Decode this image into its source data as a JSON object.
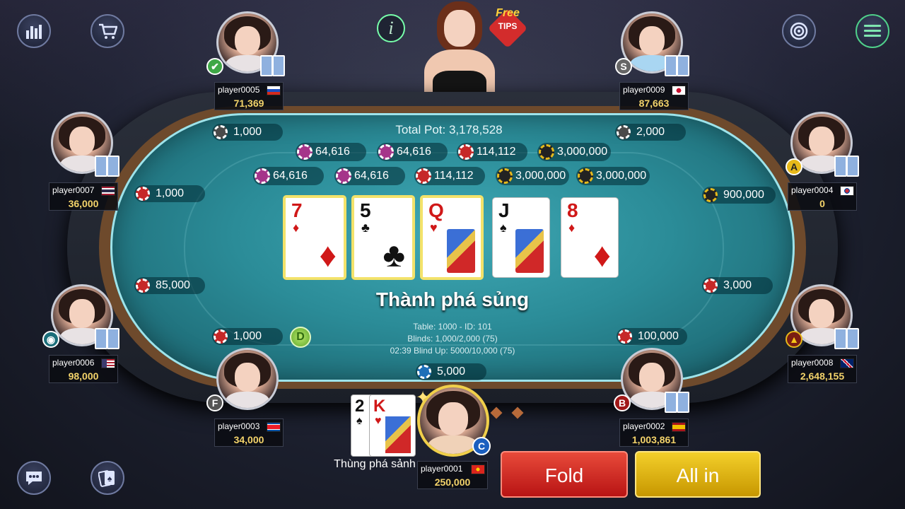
{
  "top_buttons": {
    "stats_icon": "bar-chart-icon",
    "shop_icon": "cart-icon",
    "info_icon": "info-icon",
    "target_icon": "target-icon",
    "menu_icon": "menu-icon"
  },
  "free_tips": {
    "line1": "Free",
    "line2": "TIPS"
  },
  "table": {
    "total_pot": "Total Pot: 3,178,528",
    "side_pots_row1": [
      "64,616",
      "64,616",
      "114,112",
      "3,000,000"
    ],
    "side_pots_row2": [
      "64,616",
      "64,616",
      "114,112",
      "3,000,000",
      "3,000,000"
    ],
    "hand_result": "Thành phá sủng",
    "info_line1": "Table: 1000 - ID: 101",
    "info_line2": "Blinds: 1,000/2,000 (75)",
    "info_line3": "02:39 Blind Up: 5000/10,000 (75)",
    "dealer_button": "D"
  },
  "community_cards": [
    {
      "rank": "7",
      "suit": "♦",
      "color": "red",
      "highlight": true
    },
    {
      "rank": "5",
      "suit": "♣",
      "color": "blk",
      "highlight": true
    },
    {
      "rank": "Q",
      "suit": "♥",
      "color": "red",
      "highlight": true
    },
    {
      "rank": "J",
      "suit": "♠",
      "color": "blk",
      "highlight": false
    },
    {
      "rank": "8",
      "suit": "♦",
      "color": "red",
      "highlight": false
    }
  ],
  "players": {
    "p5": {
      "name": "player0005",
      "chips": "71,369",
      "bet": "1,000"
    },
    "p9": {
      "name": "player0009",
      "chips": "87,663",
      "bet": "2,000",
      "badge": "S"
    },
    "p7": {
      "name": "player0007",
      "chips": "36,000",
      "bet": "1,000"
    },
    "p4": {
      "name": "player0004",
      "chips": "0",
      "bet": "900,000",
      "badge": "A"
    },
    "p6": {
      "name": "player0006",
      "chips": "98,000",
      "bet": "85,000"
    },
    "p8": {
      "name": "player0008",
      "chips": "2,648,155",
      "bet": "3,000"
    },
    "p3": {
      "name": "player0003",
      "chips": "34,000",
      "bet": "1,000",
      "badge": "F"
    },
    "p2": {
      "name": "player0002",
      "chips": "1,003,861",
      "bet": "100,000",
      "badge": "B"
    },
    "p1": {
      "name": "player0001",
      "chips": "250,000",
      "bet": "5,000",
      "badge": "C"
    }
  },
  "my_hand": {
    "cards": [
      {
        "rank": "2",
        "suit": "♠"
      },
      {
        "rank": "K",
        "suit": "♥"
      }
    ],
    "label": "Thùng phá sảnh"
  },
  "actions": {
    "fold": "Fold",
    "allin": "All in"
  },
  "colors": {
    "felt": "#2b8c98",
    "fold": "#c21a1a",
    "allin": "#d9a900",
    "chip_text": "#f3d36a"
  }
}
